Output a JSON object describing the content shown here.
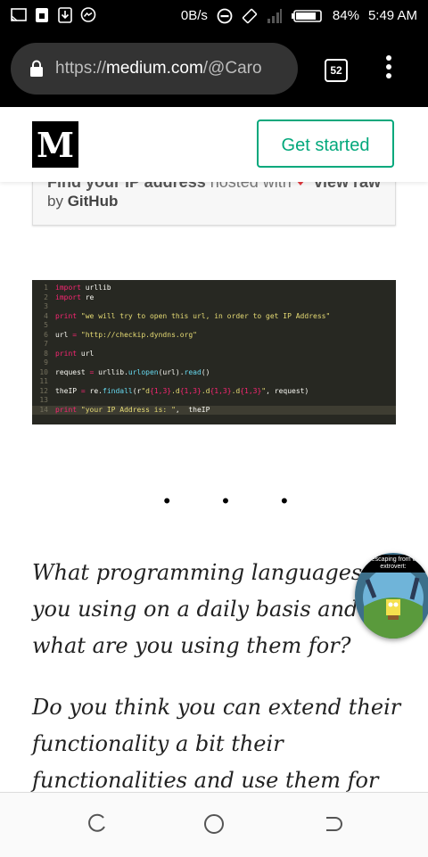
{
  "status_bar": {
    "network_speed": "0B/s",
    "battery_percent": "84%",
    "time": "5:49 AM",
    "icons": [
      "screencast-icon",
      "lock-icon",
      "download-icon",
      "messenger-icon",
      "do-not-disturb-icon",
      "rotate-icon",
      "signal-icon",
      "battery-icon"
    ]
  },
  "browser": {
    "url_scheme": "https://",
    "url_host": "medium.com",
    "url_path": "/@Caro",
    "tab_count": "52"
  },
  "header": {
    "logo": "M",
    "cta_label": "Get started"
  },
  "gist": {
    "file_line": "Find your IP address",
    "hosted_text": "hosted with",
    "view_raw": "view raw",
    "by_text": "by",
    "by_host": "GitHub"
  },
  "code": {
    "lines": [
      {
        "n": "1",
        "tokens": [
          {
            "t": "import",
            "c": "kw"
          },
          {
            "t": " urllib",
            "c": ""
          }
        ]
      },
      {
        "n": "2",
        "tokens": [
          {
            "t": "import",
            "c": "kw"
          },
          {
            "t": " re",
            "c": ""
          }
        ]
      },
      {
        "n": "3",
        "tokens": []
      },
      {
        "n": "4",
        "tokens": [
          {
            "t": "print",
            "c": "kw"
          },
          {
            "t": " ",
            "c": ""
          },
          {
            "t": "\"we will try to open this url, in order to get IP Address\"",
            "c": "str"
          }
        ]
      },
      {
        "n": "5",
        "tokens": []
      },
      {
        "n": "6",
        "tokens": [
          {
            "t": "url ",
            "c": ""
          },
          {
            "t": "=",
            "c": "op"
          },
          {
            "t": " ",
            "c": ""
          },
          {
            "t": "\"http://checkip.dyndns.org\"",
            "c": "str"
          }
        ]
      },
      {
        "n": "7",
        "tokens": []
      },
      {
        "n": "8",
        "tokens": [
          {
            "t": "print",
            "c": "kw"
          },
          {
            "t": " url",
            "c": ""
          }
        ]
      },
      {
        "n": "9",
        "tokens": []
      },
      {
        "n": "10",
        "tokens": [
          {
            "t": "request ",
            "c": ""
          },
          {
            "t": "=",
            "c": "op"
          },
          {
            "t": " urllib.",
            "c": ""
          },
          {
            "t": "urlopen",
            "c": "fn"
          },
          {
            "t": "(url).",
            "c": ""
          },
          {
            "t": "read",
            "c": "fn"
          },
          {
            "t": "()",
            "c": ""
          }
        ]
      },
      {
        "n": "11",
        "tokens": []
      },
      {
        "n": "12",
        "tokens": [
          {
            "t": "theIP ",
            "c": ""
          },
          {
            "t": "=",
            "c": "op"
          },
          {
            "t": " re.",
            "c": ""
          },
          {
            "t": "findall",
            "c": "fn"
          },
          {
            "t": "(r",
            "c": ""
          },
          {
            "t": "\"d",
            "c": "str"
          },
          {
            "t": "{1,3}",
            "c": "op"
          },
          {
            "t": ".d",
            "c": "str"
          },
          {
            "t": "{1,3}",
            "c": "op"
          },
          {
            "t": ".d",
            "c": "str"
          },
          {
            "t": "{1,3}",
            "c": "op"
          },
          {
            "t": ".d",
            "c": "str"
          },
          {
            "t": "{1,3}",
            "c": "op"
          },
          {
            "t": "\"",
            "c": "str"
          },
          {
            "t": ", request)",
            "c": ""
          }
        ]
      },
      {
        "n": "13",
        "tokens": []
      },
      {
        "n": "14",
        "hl": true,
        "tokens": [
          {
            "t": "print",
            "c": "kw"
          },
          {
            "t": " ",
            "c": ""
          },
          {
            "t": "\"your IP Address is: \"",
            "c": "str"
          },
          {
            "t": ",  theIP",
            "c": ""
          }
        ]
      }
    ]
  },
  "separator": "• • •",
  "article": {
    "paragraphs": [
      "What programming languages are you using on a daily basis and what are you using them for?",
      "Do you think you can extend their functionality a bit their functionalities and use them for"
    ]
  },
  "bubble": {
    "caption": "after escaping from chatty extrovert:"
  },
  "navbar": {
    "buttons": [
      "recent-apps-icon",
      "home-icon",
      "back-icon"
    ]
  }
}
